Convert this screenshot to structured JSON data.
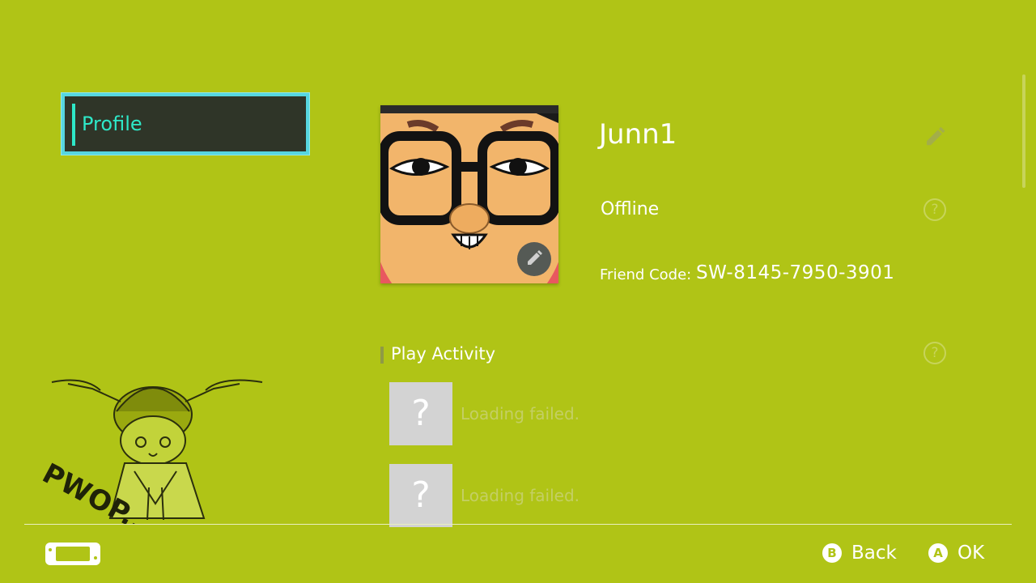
{
  "sidebar": {
    "items": [
      {
        "label": "Profile",
        "selected": true
      }
    ]
  },
  "profile": {
    "username": "Junn1",
    "status": "Offline",
    "friend_code_label": "Friend Code:",
    "friend_code": "SW-8145-7950-3901"
  },
  "play_activity": {
    "title": "Play Activity",
    "items": [
      {
        "thumb": "?",
        "text": "Loading failed."
      },
      {
        "thumb": "?",
        "text": "Loading failed."
      }
    ]
  },
  "sticker": {
    "text": "PWOP..."
  },
  "footer": {
    "back": {
      "key": "B",
      "label": "Back"
    },
    "ok": {
      "key": "A",
      "label": "OK"
    }
  },
  "colors": {
    "background": "#b0c416",
    "selection_border": "#56d6e0",
    "selection_text": "#2ee8c8"
  }
}
